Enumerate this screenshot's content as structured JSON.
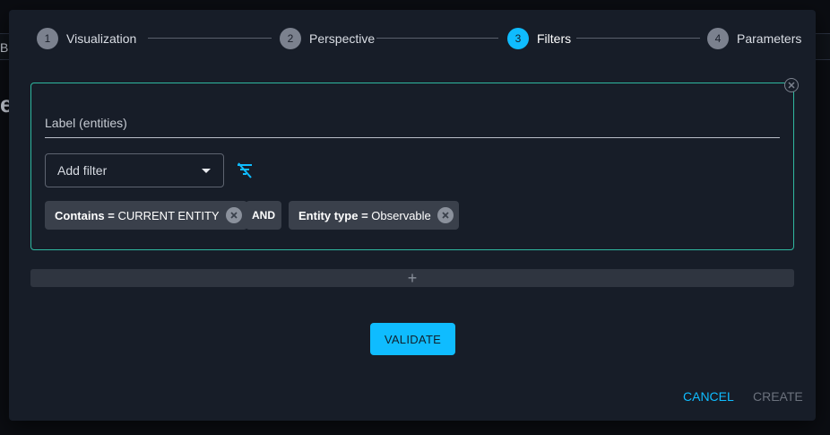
{
  "background": {
    "left_letter_top": "B",
    "left_letter_title": "e"
  },
  "stepper": {
    "steps": [
      {
        "number": "1",
        "label": "Visualization",
        "state": "done"
      },
      {
        "number": "2",
        "label": "Perspective",
        "state": "done"
      },
      {
        "number": "3",
        "label": "Filters",
        "state": "active"
      },
      {
        "number": "4",
        "label": "Parameters",
        "state": "pending"
      }
    ]
  },
  "filter_card": {
    "label_field": {
      "placeholder": "Label (entities)",
      "value": ""
    },
    "add_filter": {
      "selected": "Add filter"
    },
    "clear_icon": "filter-off-icon",
    "chips": [
      {
        "key": "Contains =",
        "value": "CURRENT ENTITY"
      },
      {
        "operator": "AND"
      },
      {
        "key": "Entity type =",
        "value": "Observable"
      }
    ]
  },
  "add_bar": {
    "symbol": "+"
  },
  "actions": {
    "validate_label": "VALIDATE",
    "cancel_label": "CANCEL",
    "create_label": "CREATE"
  },
  "colors": {
    "accent": "#0fbcff",
    "card_border": "#2fb8a0",
    "dialog_bg": "#171d28",
    "chip_bg": "#3a404b"
  }
}
